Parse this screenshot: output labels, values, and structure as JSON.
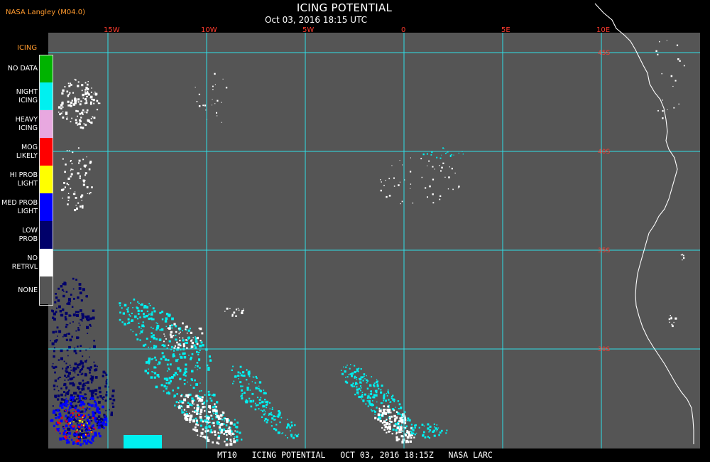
{
  "header": {
    "credit": "NASA Langley (M04.0)",
    "title": "ICING POTENTIAL",
    "subtitle": "Oct 03, 2016 18:15 UTC"
  },
  "legend": {
    "title": "ICING",
    "items": [
      {
        "label": [
          "NO DATA"
        ],
        "color": "#00b300"
      },
      {
        "label": [
          "NIGHT",
          "ICING"
        ],
        "color": "#00f0f0"
      },
      {
        "label": [
          "HEAVY",
          "ICING"
        ],
        "color": "#e8a8e0"
      },
      {
        "label": [
          "MOG",
          "LIKELY"
        ],
        "color": "#ff0000"
      },
      {
        "label": [
          "HI PROB",
          "LIGHT"
        ],
        "color": "#ffff00"
      },
      {
        "label": [
          "MED PROB",
          "LIGHT"
        ],
        "color": "#0000ff"
      },
      {
        "label": [
          "LOW",
          "PROB"
        ],
        "color": "#00006a"
      },
      {
        "label": [
          "NO",
          "RETRVL"
        ],
        "color": "#ffffff"
      },
      {
        "label": [
          "NONE"
        ],
        "color": "#555555"
      }
    ]
  },
  "map": {
    "background": "#555555",
    "grid_color": "#30e0e8",
    "coast_color": "#ffffff",
    "longitude_labels": [
      "15W",
      "10W",
      "5W",
      "0",
      "5E",
      "10E"
    ],
    "latitude_labels": [
      "45S",
      "40S",
      "35S",
      "30S"
    ]
  },
  "footer": {
    "text": "MT10   ICING POTENTIAL   OCT 03, 2016 18:15Z   NASA LARC"
  }
}
